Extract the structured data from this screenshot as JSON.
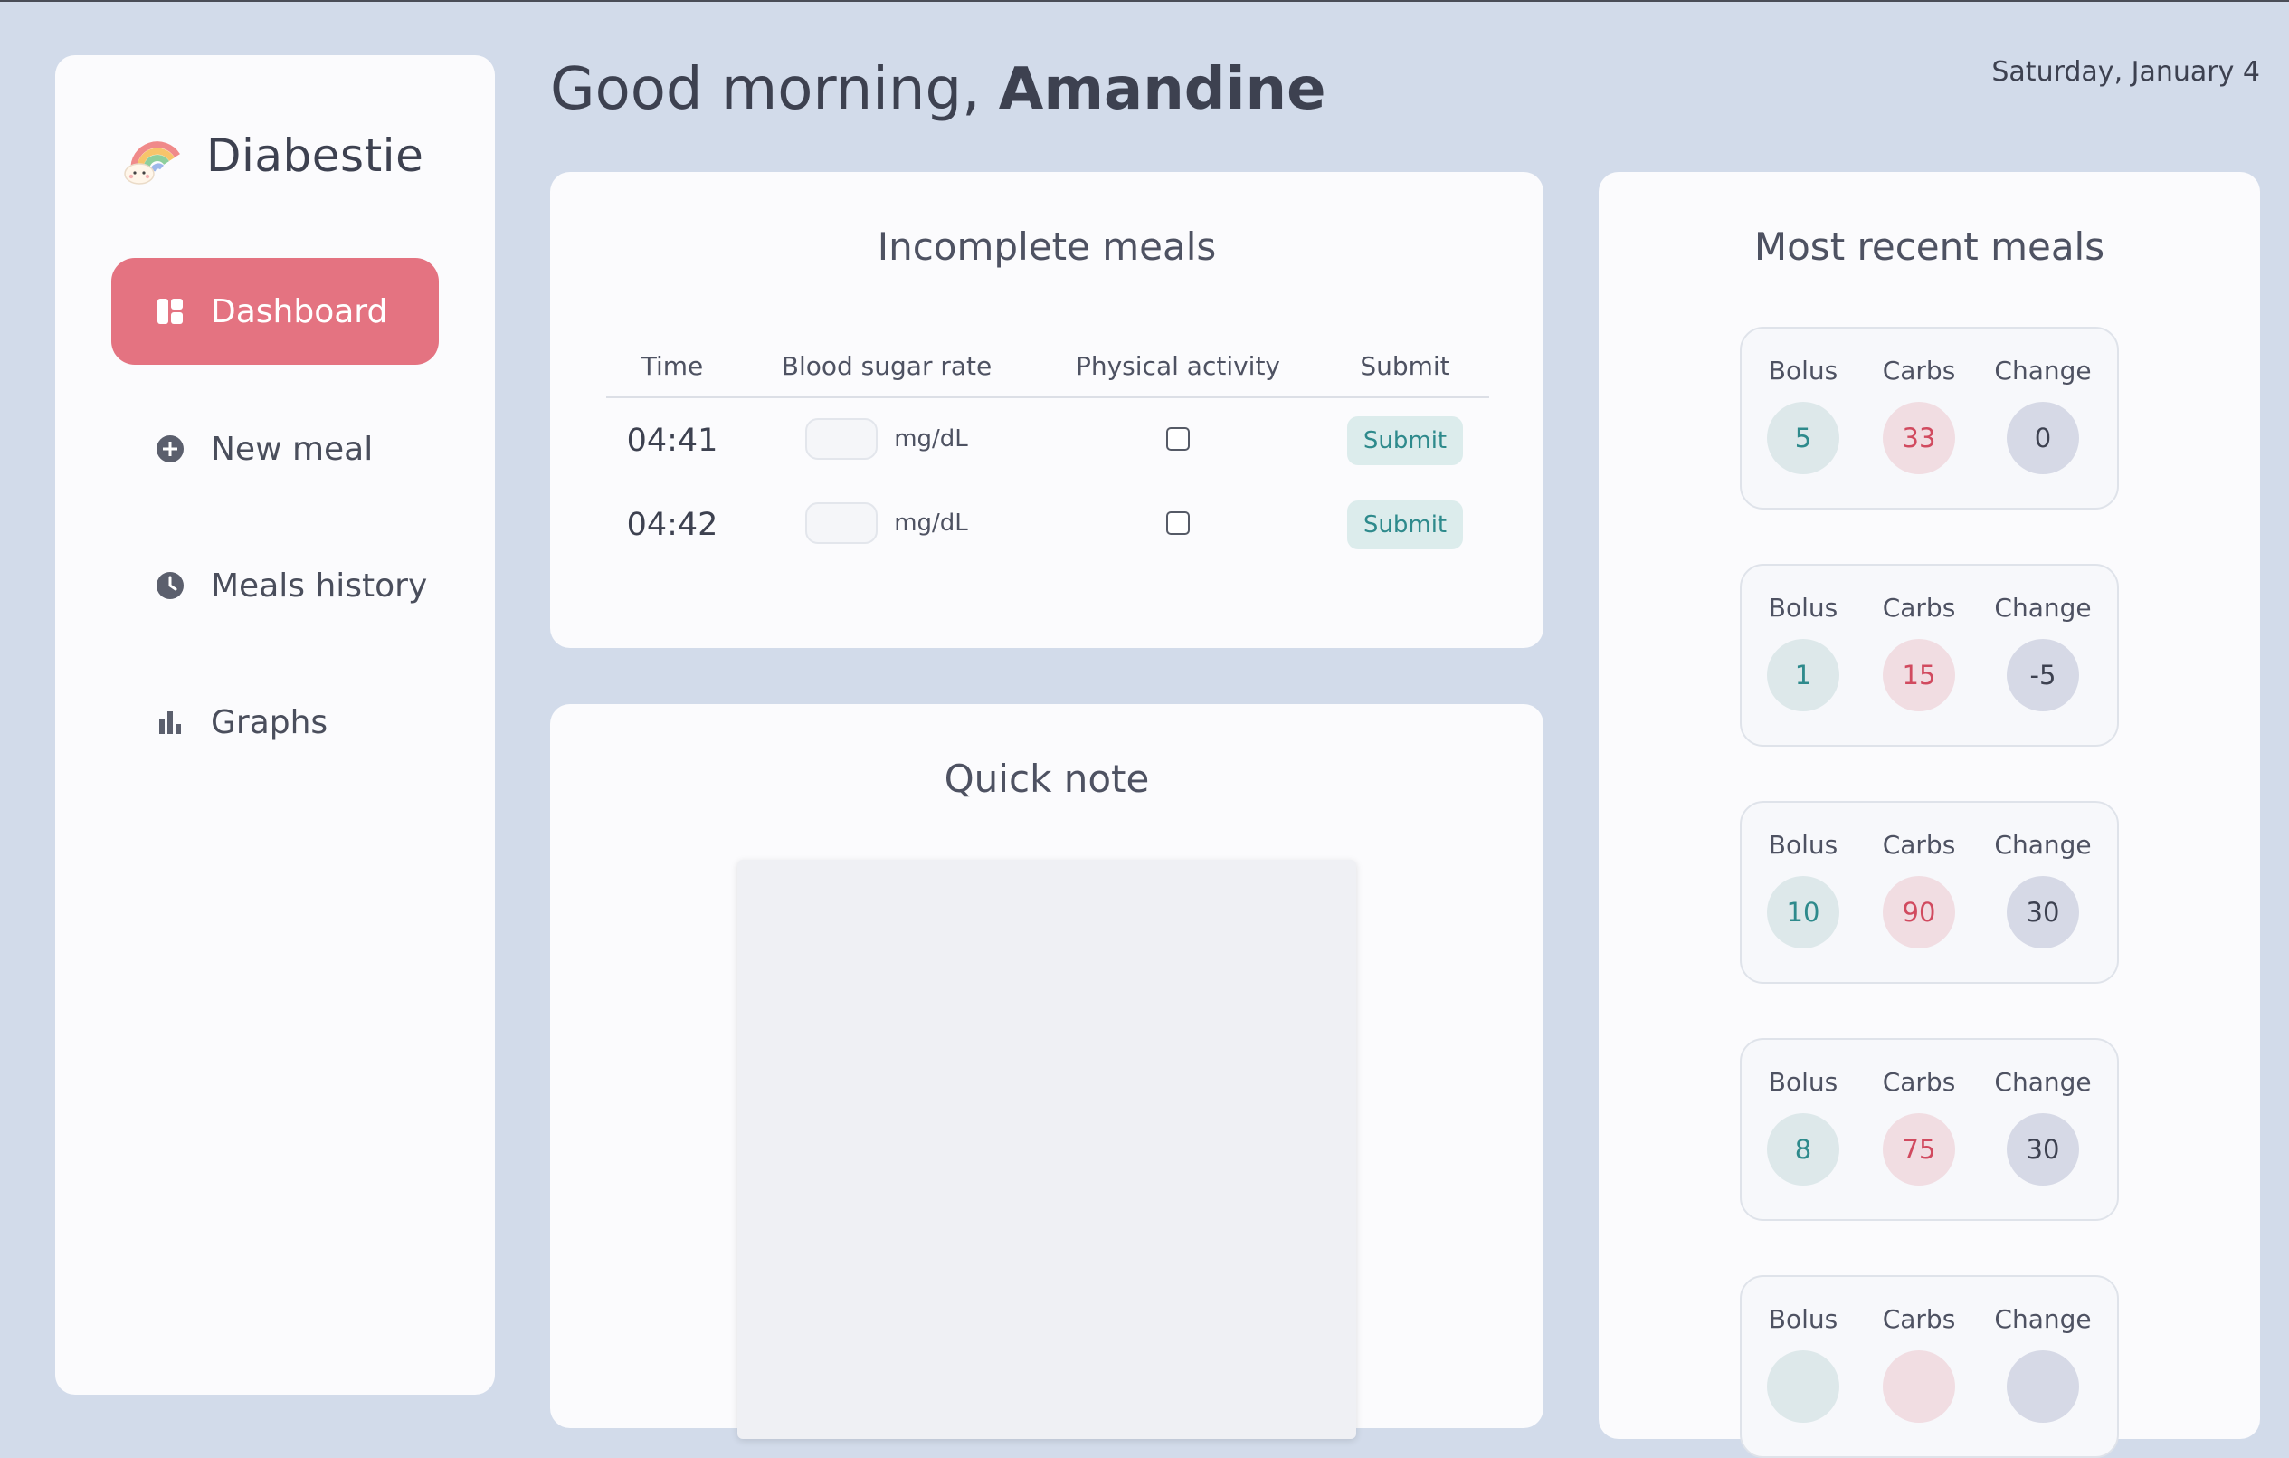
{
  "app": {
    "name": "Diabestie",
    "logo_icon": "rainbow-cloud-icon"
  },
  "colors": {
    "accent": "#e47381",
    "background": "#d2dbea",
    "teal": "#2e8a8c",
    "red": "#d14a5f"
  },
  "sidebar": {
    "items": [
      {
        "label": "Dashboard",
        "icon": "dashboard-icon",
        "active": true
      },
      {
        "label": "New meal",
        "icon": "plus-circle-icon",
        "active": false
      },
      {
        "label": "Meals history",
        "icon": "clock-icon",
        "active": false
      },
      {
        "label": "Graphs",
        "icon": "bar-chart-icon",
        "active": false
      }
    ]
  },
  "header": {
    "greeting_prefix": "Good morning,",
    "user_name": "Amandine",
    "date": "Saturday, January 4"
  },
  "incomplete_meals": {
    "title": "Incomplete meals",
    "columns": [
      "Time",
      "Blood sugar rate",
      "Physical activity",
      "Submit"
    ],
    "rows": [
      {
        "time": "04:41",
        "unit": "mg/dL",
        "sugar_value": "",
        "physical_activity": false,
        "submit_label": "Submit"
      },
      {
        "time": "04:42",
        "unit": "mg/dL",
        "sugar_value": "",
        "physical_activity": false,
        "submit_label": "Submit"
      }
    ]
  },
  "quick_note": {
    "title": "Quick note",
    "value": ""
  },
  "recent_meals": {
    "title": "Most recent meals",
    "labels": {
      "bolus": "Bolus",
      "carbs": "Carbs",
      "change": "Change"
    },
    "items": [
      {
        "bolus": "5",
        "carbs": "33",
        "change": "0"
      },
      {
        "bolus": "1",
        "carbs": "15",
        "change": "-5"
      },
      {
        "bolus": "10",
        "carbs": "90",
        "change": "30"
      },
      {
        "bolus": "8",
        "carbs": "75",
        "change": "30"
      },
      {
        "bolus": "",
        "carbs": "",
        "change": ""
      }
    ]
  }
}
